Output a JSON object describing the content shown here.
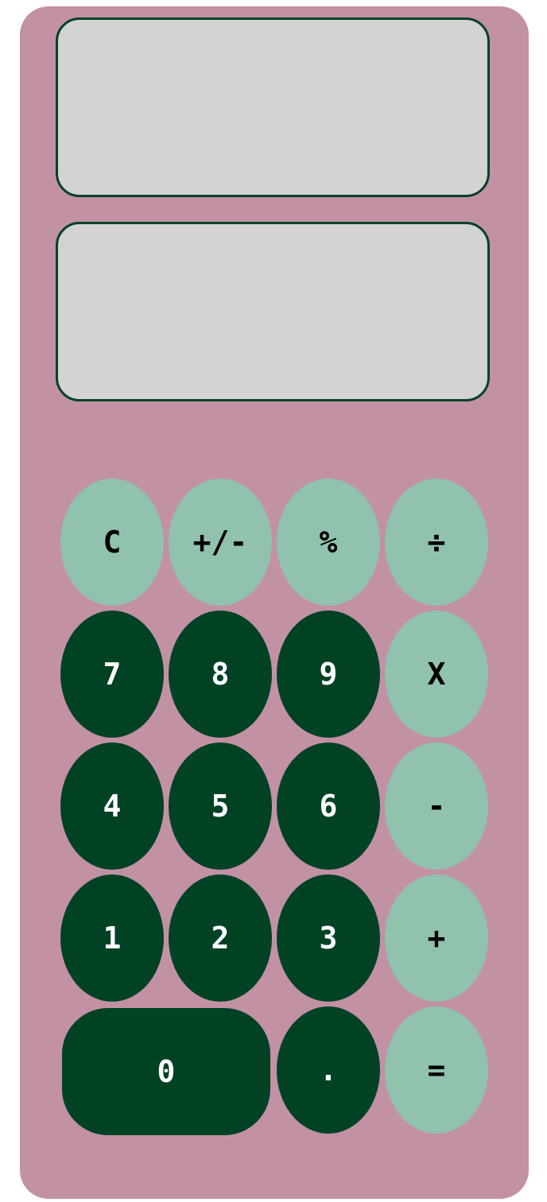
{
  "displays": {
    "expression": "",
    "result": ""
  },
  "keys": {
    "clear": "C",
    "sign": "+/-",
    "percent": "%",
    "divide": "÷",
    "seven": "7",
    "eight": "8",
    "nine": "9",
    "multiply": "X",
    "four": "4",
    "five": "5",
    "six": "6",
    "subtract": "-",
    "one": "1",
    "two": "2",
    "three": "3",
    "add": "+",
    "zero": "0",
    "decimal": ".",
    "equals": "="
  },
  "colors": {
    "body": "#c291a4",
    "screen": "#d3d3d3",
    "screen_border": "#024224",
    "digit_key": "#024224",
    "function_key": "#90c2ae"
  }
}
